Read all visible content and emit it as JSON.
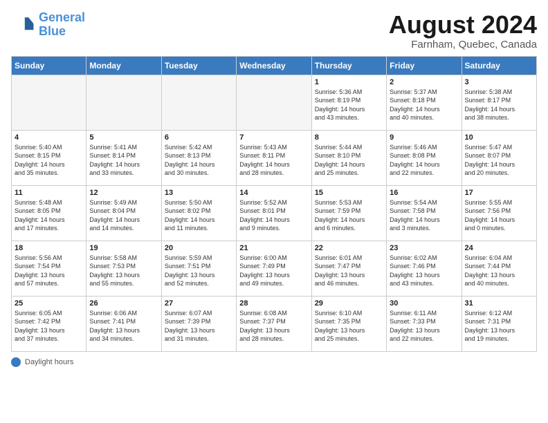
{
  "header": {
    "logo_general": "General",
    "logo_blue": "Blue",
    "month_title": "August 2024",
    "location": "Farnham, Quebec, Canada"
  },
  "days_of_week": [
    "Sunday",
    "Monday",
    "Tuesday",
    "Wednesday",
    "Thursday",
    "Friday",
    "Saturday"
  ],
  "weeks": [
    [
      {
        "day": "",
        "info": ""
      },
      {
        "day": "",
        "info": ""
      },
      {
        "day": "",
        "info": ""
      },
      {
        "day": "",
        "info": ""
      },
      {
        "day": "1",
        "info": "Sunrise: 5:36 AM\nSunset: 8:19 PM\nDaylight: 14 hours\nand 43 minutes."
      },
      {
        "day": "2",
        "info": "Sunrise: 5:37 AM\nSunset: 8:18 PM\nDaylight: 14 hours\nand 40 minutes."
      },
      {
        "day": "3",
        "info": "Sunrise: 5:38 AM\nSunset: 8:17 PM\nDaylight: 14 hours\nand 38 minutes."
      }
    ],
    [
      {
        "day": "4",
        "info": "Sunrise: 5:40 AM\nSunset: 8:15 PM\nDaylight: 14 hours\nand 35 minutes."
      },
      {
        "day": "5",
        "info": "Sunrise: 5:41 AM\nSunset: 8:14 PM\nDaylight: 14 hours\nand 33 minutes."
      },
      {
        "day": "6",
        "info": "Sunrise: 5:42 AM\nSunset: 8:13 PM\nDaylight: 14 hours\nand 30 minutes."
      },
      {
        "day": "7",
        "info": "Sunrise: 5:43 AM\nSunset: 8:11 PM\nDaylight: 14 hours\nand 28 minutes."
      },
      {
        "day": "8",
        "info": "Sunrise: 5:44 AM\nSunset: 8:10 PM\nDaylight: 14 hours\nand 25 minutes."
      },
      {
        "day": "9",
        "info": "Sunrise: 5:46 AM\nSunset: 8:08 PM\nDaylight: 14 hours\nand 22 minutes."
      },
      {
        "day": "10",
        "info": "Sunrise: 5:47 AM\nSunset: 8:07 PM\nDaylight: 14 hours\nand 20 minutes."
      }
    ],
    [
      {
        "day": "11",
        "info": "Sunrise: 5:48 AM\nSunset: 8:05 PM\nDaylight: 14 hours\nand 17 minutes."
      },
      {
        "day": "12",
        "info": "Sunrise: 5:49 AM\nSunset: 8:04 PM\nDaylight: 14 hours\nand 14 minutes."
      },
      {
        "day": "13",
        "info": "Sunrise: 5:50 AM\nSunset: 8:02 PM\nDaylight: 14 hours\nand 11 minutes."
      },
      {
        "day": "14",
        "info": "Sunrise: 5:52 AM\nSunset: 8:01 PM\nDaylight: 14 hours\nand 9 minutes."
      },
      {
        "day": "15",
        "info": "Sunrise: 5:53 AM\nSunset: 7:59 PM\nDaylight: 14 hours\nand 6 minutes."
      },
      {
        "day": "16",
        "info": "Sunrise: 5:54 AM\nSunset: 7:58 PM\nDaylight: 14 hours\nand 3 minutes."
      },
      {
        "day": "17",
        "info": "Sunrise: 5:55 AM\nSunset: 7:56 PM\nDaylight: 14 hours\nand 0 minutes."
      }
    ],
    [
      {
        "day": "18",
        "info": "Sunrise: 5:56 AM\nSunset: 7:54 PM\nDaylight: 13 hours\nand 57 minutes."
      },
      {
        "day": "19",
        "info": "Sunrise: 5:58 AM\nSunset: 7:53 PM\nDaylight: 13 hours\nand 55 minutes."
      },
      {
        "day": "20",
        "info": "Sunrise: 5:59 AM\nSunset: 7:51 PM\nDaylight: 13 hours\nand 52 minutes."
      },
      {
        "day": "21",
        "info": "Sunrise: 6:00 AM\nSunset: 7:49 PM\nDaylight: 13 hours\nand 49 minutes."
      },
      {
        "day": "22",
        "info": "Sunrise: 6:01 AM\nSunset: 7:47 PM\nDaylight: 13 hours\nand 46 minutes."
      },
      {
        "day": "23",
        "info": "Sunrise: 6:02 AM\nSunset: 7:46 PM\nDaylight: 13 hours\nand 43 minutes."
      },
      {
        "day": "24",
        "info": "Sunrise: 6:04 AM\nSunset: 7:44 PM\nDaylight: 13 hours\nand 40 minutes."
      }
    ],
    [
      {
        "day": "25",
        "info": "Sunrise: 6:05 AM\nSunset: 7:42 PM\nDaylight: 13 hours\nand 37 minutes."
      },
      {
        "day": "26",
        "info": "Sunrise: 6:06 AM\nSunset: 7:41 PM\nDaylight: 13 hours\nand 34 minutes."
      },
      {
        "day": "27",
        "info": "Sunrise: 6:07 AM\nSunset: 7:39 PM\nDaylight: 13 hours\nand 31 minutes."
      },
      {
        "day": "28",
        "info": "Sunrise: 6:08 AM\nSunset: 7:37 PM\nDaylight: 13 hours\nand 28 minutes."
      },
      {
        "day": "29",
        "info": "Sunrise: 6:10 AM\nSunset: 7:35 PM\nDaylight: 13 hours\nand 25 minutes."
      },
      {
        "day": "30",
        "info": "Sunrise: 6:11 AM\nSunset: 7:33 PM\nDaylight: 13 hours\nand 22 minutes."
      },
      {
        "day": "31",
        "info": "Sunrise: 6:12 AM\nSunset: 7:31 PM\nDaylight: 13 hours\nand 19 minutes."
      }
    ]
  ],
  "footer": {
    "label": "Daylight hours"
  }
}
